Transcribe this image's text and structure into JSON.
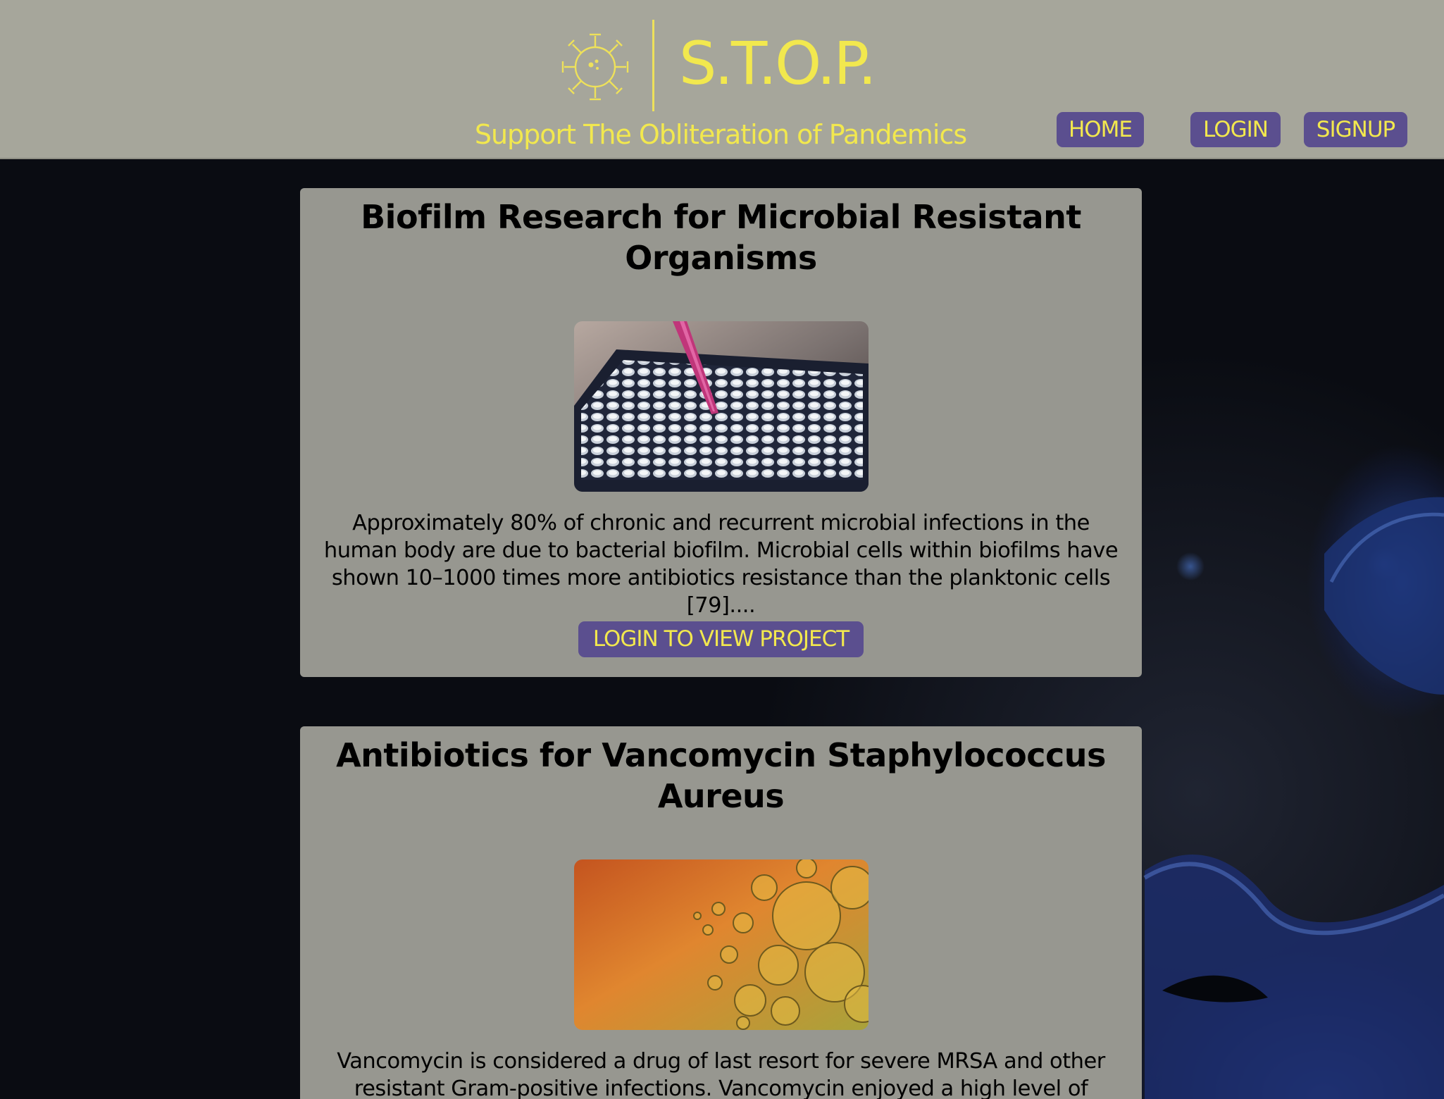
{
  "header": {
    "brand": "S.T.O.P.",
    "tagline": "Support The Obliteration of Pandemics",
    "logo_icon": "virus-icon",
    "accent_color": "#f2e84e",
    "bar_color": "#a6a69b"
  },
  "nav": {
    "home": "HOME",
    "login": "LOGIN",
    "signup": "SIGNUP",
    "button_color": "#5b4f8f"
  },
  "projects": [
    {
      "title": "Biofilm Research for Microbial Resistant Organisms",
      "image": "well-plate-pipette-photo",
      "description": "Approximately 80% of chronic and recurrent microbial infections in the human body are due to bacterial biofilm. Microbial cells within biofilms have shown 10–1000 times more antibiotics resistance than the planktonic cells [79]....",
      "button": "LOGIN TO VIEW PROJECT"
    },
    {
      "title": "Antibiotics for Vancomycin Staphylococcus Aureus",
      "image": "orange-bubbles-microscopy-photo",
      "description": "Vancomycin is considered a drug of last resort for severe MRSA and other resistant Gram-positive infections. Vancomycin enjoyed a high level of success"
    }
  ]
}
